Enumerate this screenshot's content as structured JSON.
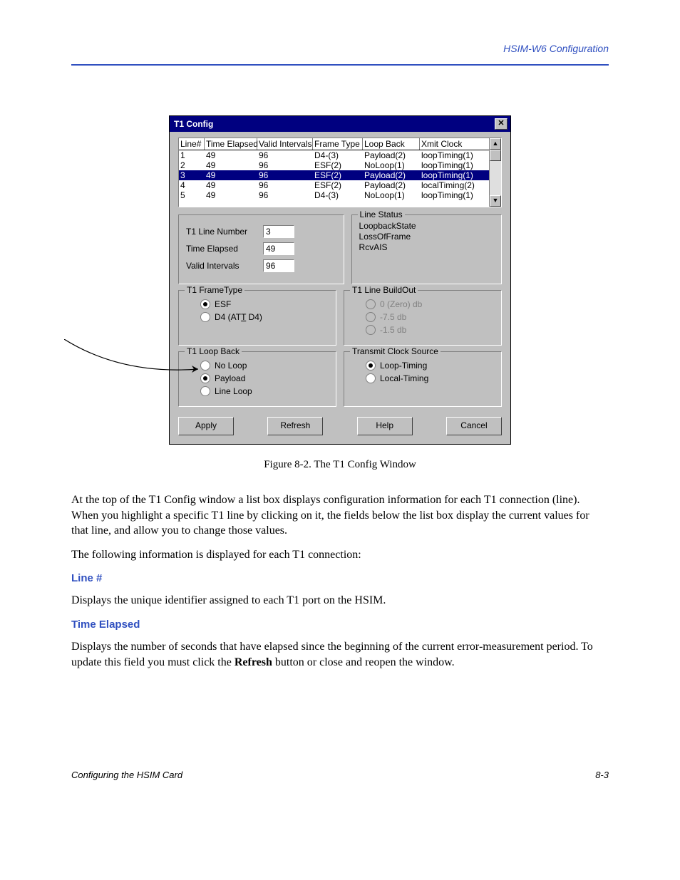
{
  "header": {
    "right": "HSIM-W6 Configuration"
  },
  "dialog": {
    "title": "T1 Config",
    "columns": [
      "Line#",
      "Time Elapsed",
      "Valid Intervals",
      "Frame Type",
      "Loop Back",
      "Xmit Clock"
    ],
    "rows": [
      {
        "line": "1",
        "te": "49",
        "vi": "96",
        "ft": "D4-(3)",
        "lb": "Payload(2)",
        "xc": "loopTiming(1)"
      },
      {
        "line": "2",
        "te": "49",
        "vi": "96",
        "ft": "ESF(2)",
        "lb": "NoLoop(1)",
        "xc": "loopTiming(1)"
      },
      {
        "line": "3",
        "te": "49",
        "vi": "96",
        "ft": "ESF(2)",
        "lb": "Payload(2)",
        "xc": "loopTiming(1)",
        "selected": true
      },
      {
        "line": "4",
        "te": "49",
        "vi": "96",
        "ft": "ESF(2)",
        "lb": "Payload(2)",
        "xc": "localTiming(2)"
      },
      {
        "line": "5",
        "te": "49",
        "vi": "96",
        "ft": "D4-(3)",
        "lb": "NoLoop(1)",
        "xc": "loopTiming(1)"
      }
    ],
    "fields": {
      "line_number_label": "T1 Line Number",
      "line_number_value": "3",
      "time_elapsed_label": "Time Elapsed",
      "time_elapsed_value": "49",
      "valid_intervals_label": "Valid Intervals",
      "valid_intervals_value": "96"
    },
    "line_status": {
      "legend": "Line Status",
      "items": [
        "LoopbackState",
        "LossOfFrame",
        "RcvAIS"
      ]
    },
    "frame_type": {
      "legend": "T1 FrameType",
      "esf": "ESF",
      "d4_prefix": "D4 (AT",
      "d4_underline": "T",
      "d4_suffix": " D4)",
      "selected": "esf"
    },
    "buildout": {
      "legend": "T1 Line BuildOut",
      "opt0": "0 (Zero) db",
      "opt75": "-7.5 db",
      "opt15": "-1.5 db"
    },
    "loopback": {
      "legend": "T1 Loop Back",
      "noloop": "No Loop",
      "payload": "Payload",
      "lineloop": "Line Loop",
      "selected": "payload"
    },
    "clock": {
      "legend": "Transmit Clock Source",
      "loop": "Loop-Timing",
      "local": "Local-Timing",
      "selected": "loop"
    },
    "buttons": {
      "apply": "Apply",
      "refresh": "Refresh",
      "help": "Help",
      "cancel": "Cancel"
    },
    "close_glyph": "✕"
  },
  "caption": "Figure 8-2.  The T1 Config Window",
  "para1": "At the top of the T1 Config window a list box displays configuration information for each T1 connection (line). When you highlight a specific T1 line by clicking on it, the fields below the list box display the current values for that line, and allow you to change those values.",
  "para2": "The following information is displayed for each T1 connection:",
  "heads": {
    "line_no": "Line #",
    "time_elapsed": "Time Elapsed"
  },
  "para3": "Displays the unique identifier assigned to each T1 port on the HSIM.",
  "para4a": "Displays the number of seconds that have elapsed since the beginning of the current error-measurement period. To update this field you must click the ",
  "para4_bold": "Refresh",
  "para4b": " button or close and reopen the window.",
  "footer": {
    "left": "Configuring the HSIM Card",
    "right": "8-3"
  }
}
